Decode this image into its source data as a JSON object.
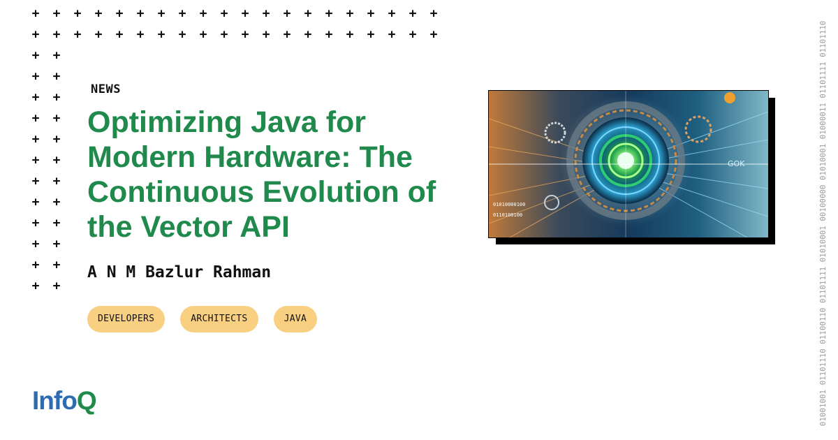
{
  "article": {
    "kicker": "NEWS",
    "title": "Optimizing Java for Modern Hardware: The Continuous Evolution of the Vector API",
    "author": "A N M Bazlur Rahman",
    "tags": [
      "DEVELOPERS",
      "ARCHITECTS",
      "JAVA"
    ]
  },
  "brand": {
    "logo_part1": "Info",
    "logo_part2": "Q",
    "logo_color_blue": "#2f6bb0",
    "logo_color_green": "#1f8a4c"
  },
  "side_binary": "01001001 01101110 01100110 01101111 01010001 00100000 01010001 01000011 01101111 01101110",
  "hero_image": {
    "icon": "vector-api-abstract-illustration",
    "overlay_text_left": "01010000100",
    "overlay_text_left2": "0110100100",
    "overlay_text_right": "GOK"
  },
  "colors": {
    "title": "#1f8a4c",
    "tag_bg": "#f9cf82",
    "plus": "#111111"
  }
}
